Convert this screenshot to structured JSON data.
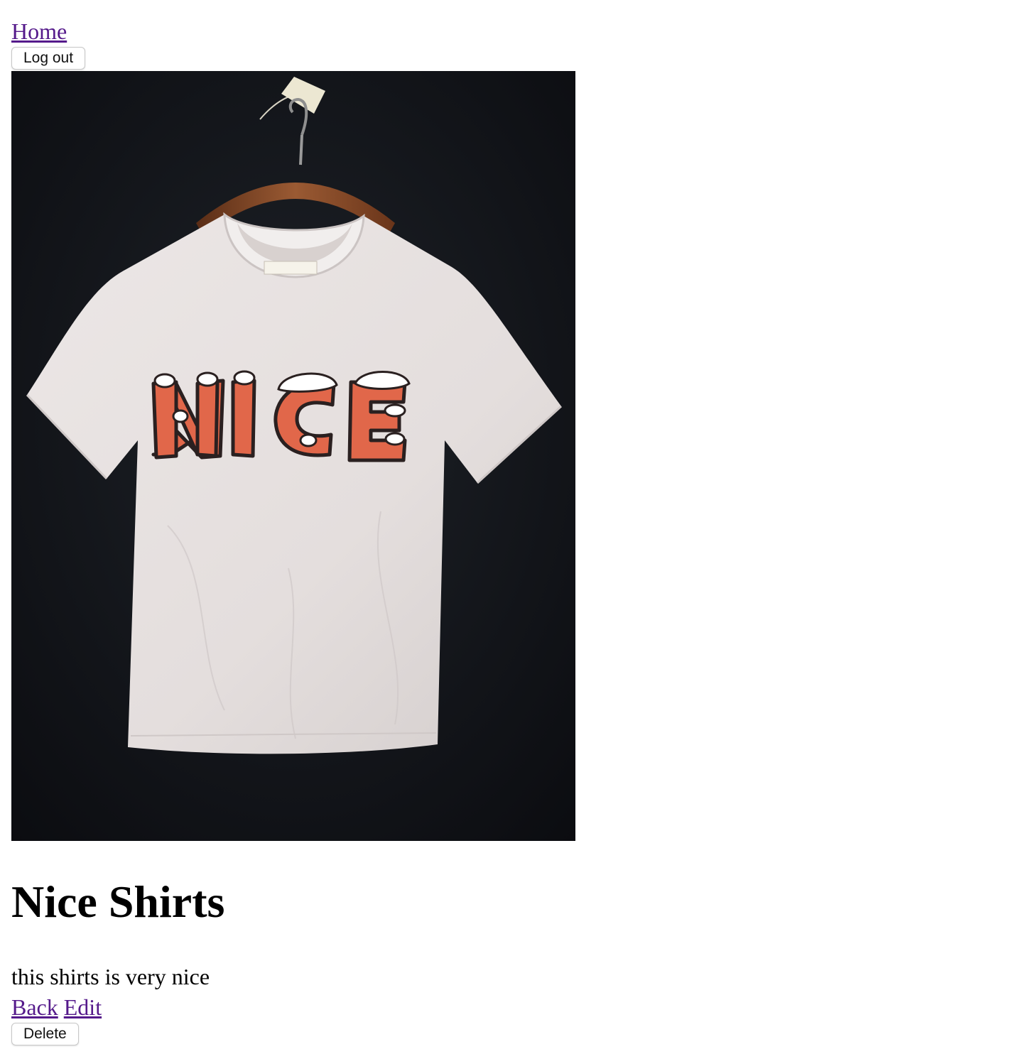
{
  "nav": {
    "home_label": "Home",
    "logout_label": "Log out"
  },
  "product": {
    "image_alt": "NICE",
    "title": "Nice Shirts",
    "description": "this shirts is very nice"
  },
  "actions": {
    "back_label": "Back",
    "edit_label": "Edit",
    "delete_label": "Delete"
  },
  "colors": {
    "link": "#551a8b",
    "shirt_print": "#e1674a",
    "background_dark": "#111318"
  }
}
